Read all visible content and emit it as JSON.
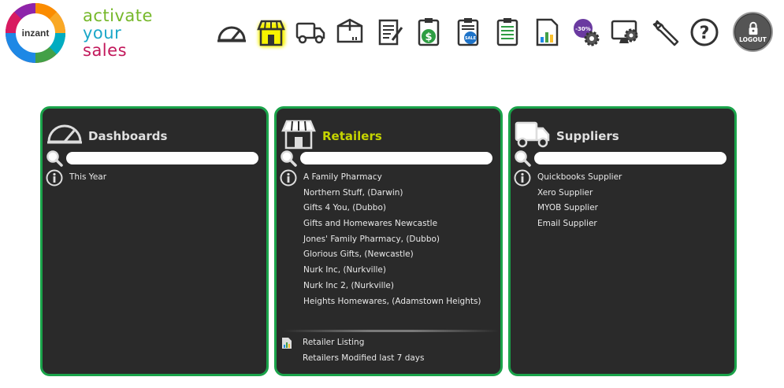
{
  "brand": {
    "logo_text": "inzant",
    "tagline": [
      "activate",
      "your",
      "sales"
    ]
  },
  "toolbar": {
    "items": [
      {
        "name": "dashboard-icon"
      },
      {
        "name": "store-icon",
        "active": true
      },
      {
        "name": "truck-icon"
      },
      {
        "name": "box-icon"
      },
      {
        "name": "notepad-icon"
      },
      {
        "name": "dollar-clipboard-icon"
      },
      {
        "name": "sale-clipboard-icon"
      },
      {
        "name": "list-clipboard-icon"
      },
      {
        "name": "report-chart-icon"
      },
      {
        "name": "discount-gear-icon",
        "badge": "-30%"
      },
      {
        "name": "computer-settings-icon"
      },
      {
        "name": "wrench-icon"
      },
      {
        "name": "help-icon"
      }
    ],
    "logout_label": "LOGOUT",
    "highlight_color": "#f7f200"
  },
  "panels": {
    "dashboards": {
      "title": "Dashboards",
      "search_value": "",
      "items": [
        "This Year"
      ]
    },
    "retailers": {
      "title": "Retailers",
      "search_value": "",
      "items": [
        "A Family Pharmacy",
        "Northern Stuff, (Darwin)",
        "Gifts 4 You, (Dubbo)",
        "Gifts and Homewares Newcastle",
        "Jones' Family Pharmacy, (Dubbo)",
        "Glorious Gifts, (Newcastle)",
        "Nurk Inc, (Nurkville)",
        "Nurk Inc 2, (Nurkville)",
        "Heights Homewares, (Adamstown Heights)"
      ],
      "links": [
        "Retailer Listing",
        "Retailers Modified last 7 days"
      ]
    },
    "suppliers": {
      "title": "Suppliers",
      "search_value": "",
      "items": [
        "Quickbooks Supplier",
        "Xero Supplier",
        "MYOB Supplier",
        "Email Supplier"
      ]
    }
  },
  "colors": {
    "panel_border": "#1aa34a",
    "panel_bg": "#2a2a2a",
    "title_highlight": "#c5d400"
  }
}
